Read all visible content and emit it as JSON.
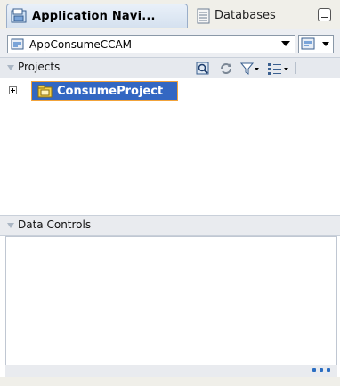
{
  "tabs": {
    "app_navigator": "Application Navi...",
    "databases": "Databases"
  },
  "application": {
    "selected": "AppConsumeCCAM"
  },
  "projects": {
    "header": "Projects",
    "tree": [
      {
        "label": "ConsumeProject",
        "expanded": false,
        "selected": true
      }
    ]
  },
  "data_controls": {
    "header": "Data Controls"
  },
  "colors": {
    "selection": "#3367c2",
    "selection_border": "#f2a33a",
    "tab_active": "#d5e1ef"
  }
}
